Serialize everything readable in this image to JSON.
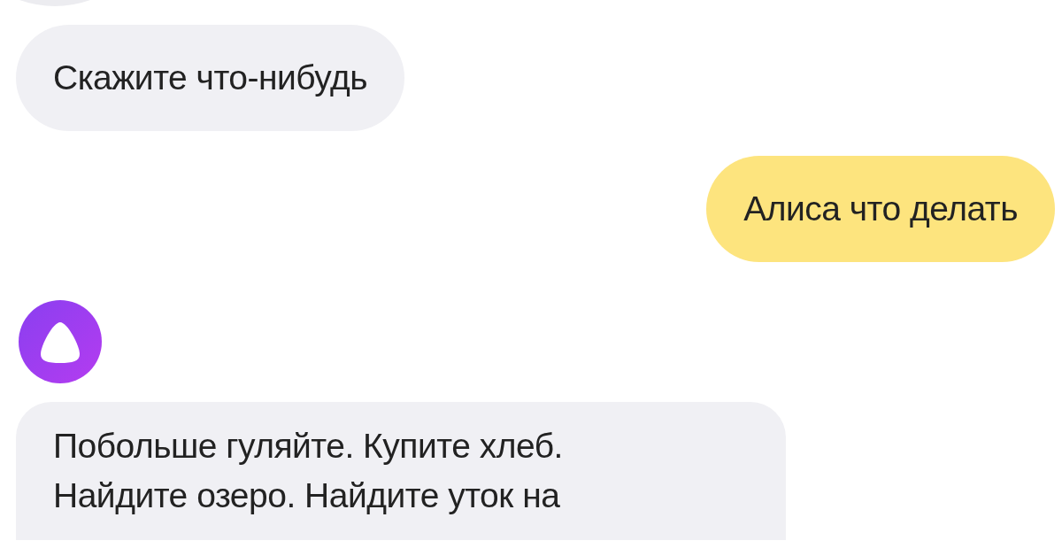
{
  "messages": [
    {
      "kind": "avatar-partial"
    },
    {
      "kind": "incoming",
      "text": "Скажите что-нибудь"
    },
    {
      "kind": "outgoing",
      "text": "Алиса что делать"
    },
    {
      "kind": "assistant-avatar"
    },
    {
      "kind": "incoming-cut",
      "text": "Побольше гуляйте. Купите хлеб. Найдите озеро. Найдите уток на"
    }
  ]
}
